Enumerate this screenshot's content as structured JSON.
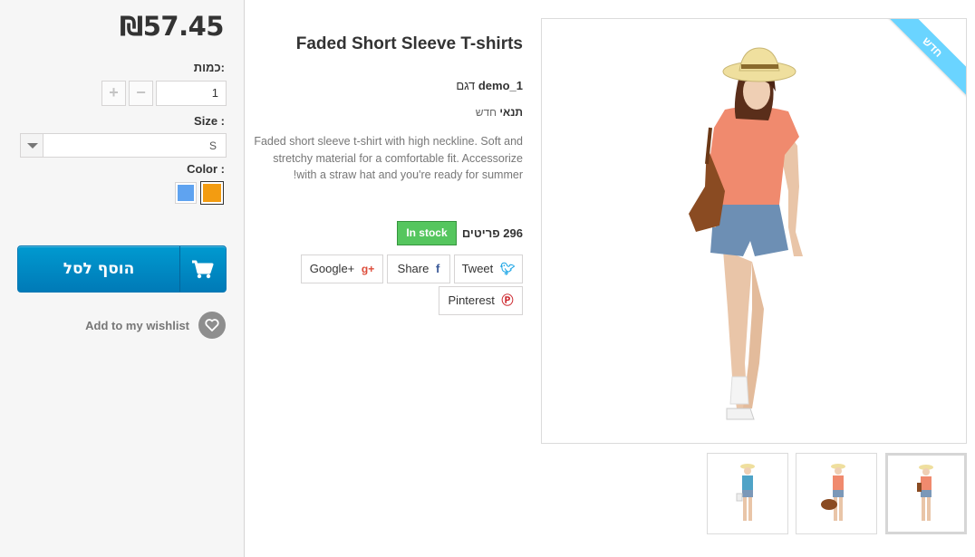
{
  "buy_box": {
    "price": "₪57.45",
    "quantity_label": "כמות:",
    "quantity_value": "1",
    "size_label": "Size :",
    "size_selected": "S",
    "color_label": "Color :",
    "colors": [
      "#5fa3f0",
      "#f39c11"
    ],
    "add_to_cart_label": "הוסף לסל",
    "wishlist_label": "Add to my wishlist",
    "accent_color": "#0a8ec5"
  },
  "product": {
    "title": "Faded Short Sleeve T-shirts",
    "reference_label": "דגם",
    "reference_value": "demo_1",
    "condition_label": "תנאי",
    "condition_value": "חדש",
    "description": "Faded short sleeve t-shirt with high neckline. Soft and stretchy material for a comfortable fit. Accessorize with a straw hat and you're ready for summer!",
    "quantity_count": "296",
    "quantity_unit": "פריטים",
    "availability": "In stock",
    "availability_color": "#55c65e"
  },
  "share": {
    "tweet": "Tweet",
    "share": "Share",
    "google": "Google+",
    "pinterest": "Pinterest"
  },
  "images": {
    "new_badge": "חדש",
    "thumbnails": [
      "thumb-blue-top",
      "thumb-orange-top-bag",
      "thumb-orange-top-hat"
    ]
  }
}
